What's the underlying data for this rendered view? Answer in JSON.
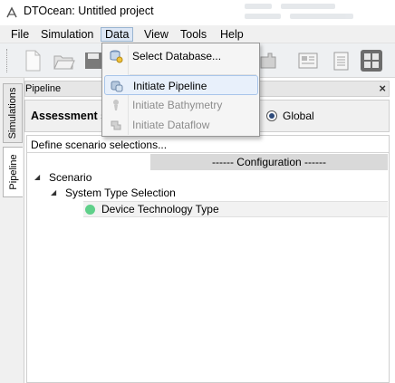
{
  "window": {
    "title": "DTOcean: Untitled project",
    "app_icon": "dtocean-logo-icon"
  },
  "menubar": {
    "items": [
      {
        "label": "File"
      },
      {
        "label": "Simulation"
      },
      {
        "label": "Data"
      },
      {
        "label": "View"
      },
      {
        "label": "Tools"
      },
      {
        "label": "Help"
      }
    ],
    "active": "Data"
  },
  "toolbar": {
    "buttons": [
      {
        "icon": "new-document-icon"
      },
      {
        "icon": "open-folder-icon"
      },
      {
        "icon": "save-disk-icon"
      },
      {
        "icon": "plugin-icon"
      },
      {
        "icon": "report-icon"
      },
      {
        "icon": "clipboard-icon"
      },
      {
        "icon": "tools-grid-icon"
      }
    ]
  },
  "data_menu": {
    "items": [
      {
        "label": "Select Database...",
        "icon": "database-select-icon",
        "enabled": true
      },
      {
        "label": "Initiate Pipeline",
        "icon": "pipeline-icon",
        "enabled": true,
        "highlighted": true
      },
      {
        "label": "Initiate Bathymetry",
        "icon": "bathymetry-icon",
        "enabled": false
      },
      {
        "label": "Initiate Dataflow",
        "icon": "dataflow-icon",
        "enabled": false
      }
    ]
  },
  "left_tabs": [
    {
      "label": "Simulations"
    },
    {
      "label": "Pipeline",
      "selected": true
    }
  ],
  "panel": {
    "title": "Pipeline",
    "close": "×",
    "assessment_label": "Assessment s",
    "radio_label": "Global",
    "define_text": "Define scenario selections...",
    "config_text": "------   Configuration   ------",
    "tree": {
      "scenario": "Scenario",
      "system_type": "System Type Selection",
      "device_tech": "Device Technology Type"
    }
  },
  "colors": {
    "menu_highlight": "#e8f0fb",
    "status_green": "#5fd08a",
    "config_band": "#d9d9d9"
  }
}
